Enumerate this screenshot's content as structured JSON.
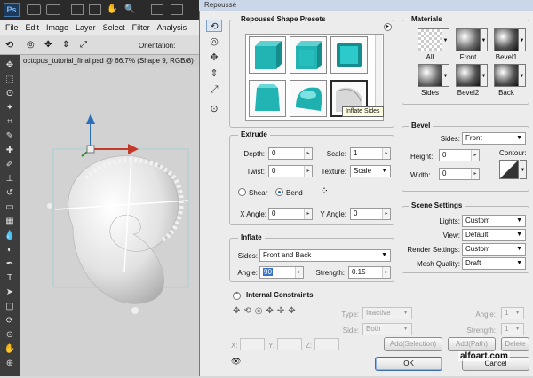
{
  "photoshop": {
    "menu": [
      "File",
      "Edit",
      "Image",
      "Layer",
      "Select",
      "Filter",
      "Analysis"
    ],
    "ps_badge": "Ps",
    "options_label": "Orientation:",
    "document_tab": "octopus_tutorial_final.psd @ 66.7% (Shape 9, RGB/8)"
  },
  "dialog": {
    "title": "Repoussé",
    "presets": {
      "title": "Repoussé Shape Presets",
      "tooltip": "Inflate Sides"
    },
    "extrude": {
      "title": "Extrude",
      "depth_label": "Depth:",
      "depth_value": "0",
      "scale_label": "Scale:",
      "scale_value": "1",
      "twist_label": "Twist:",
      "twist_value": "0",
      "texture_label": "Texture:",
      "texture_value": "Scale",
      "shear_label": "Shear",
      "bend_label": "Bend",
      "xangle_label": "X Angle:",
      "xangle_value": "0",
      "yangle_label": "Y Angle:",
      "yangle_value": "0"
    },
    "inflate": {
      "title": "Inflate",
      "sides_label": "Sides:",
      "sides_value": "Front and Back",
      "angle_label": "Angle:",
      "angle_value": "90",
      "strength_label": "Strength:",
      "strength_value": "0.15"
    },
    "materials": {
      "title": "Materials",
      "items": [
        "All",
        "Front",
        "Bevel1",
        "Sides",
        "Bevel2",
        "Back"
      ]
    },
    "bevel": {
      "title": "Bevel",
      "sides_label": "Sides:",
      "sides_value": "Front",
      "height_label": "Height:",
      "height_value": "0",
      "width_label": "Width:",
      "width_value": "0",
      "contour_label": "Contour:"
    },
    "scene": {
      "title": "Scene Settings",
      "lights_label": "Lights:",
      "lights_value": "Custom",
      "view_label": "View:",
      "view_value": "Default",
      "render_label": "Render Settings:",
      "render_value": "Custom",
      "quality_label": "Mesh Quality:",
      "quality_value": "Draft"
    },
    "constraints": {
      "title": "Internal Constraints",
      "type_label": "Type:",
      "type_value": "Inactive",
      "side_label": "Side:",
      "side_value": "Both",
      "angle_label": "Angle:",
      "angle_value": "1",
      "strength_label": "Strength:",
      "strength_value": "1",
      "x_label": "X:",
      "y_label": "Y:",
      "z_label": "Z:",
      "add_selection": "Add(Selection)",
      "add_path": "Add(Path)",
      "delete": "Delete"
    },
    "ok": "OK",
    "cancel": "Cancel",
    "watermark": "alfoart.com"
  }
}
